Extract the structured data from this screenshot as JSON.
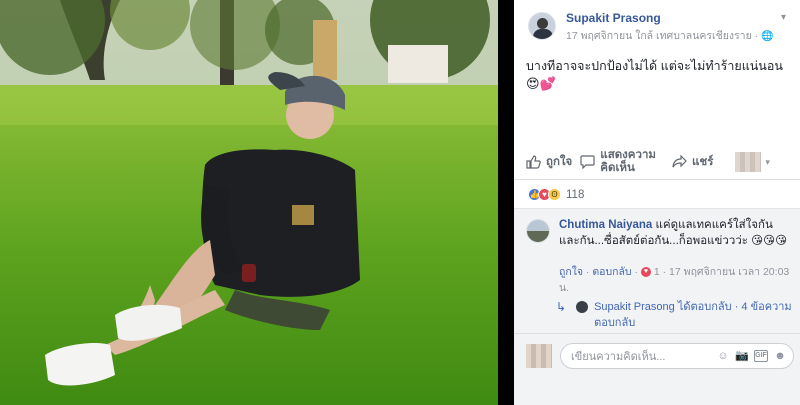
{
  "post": {
    "author": "Supakit Prasong",
    "meta": "17 พฤศจิกายน ใกล้ เทศบาลนครเชียงราย · ",
    "text": "บางทีอาจจะปกป้องไม่ได้ แต่จะไม่ทำร้ายแน่นอน",
    "text_emojis": "😍💕"
  },
  "actions": {
    "like": "ถูกใจ",
    "comment_line1": "แสดงความ",
    "comment_line2": "คิดเห็น",
    "share": "แชร์"
  },
  "reactions": {
    "count": "118",
    "types": [
      "like-icon",
      "love-icon",
      "wow-icon"
    ]
  },
  "comment": {
    "author": "Chutima Naiyana",
    "text": "แค่ดูแลเทคแคร์ใส่ใจกันและกัน...ซื่อสัตย์ต่อกัน...ก็อพอแข่ววว่ะ",
    "emojis": "😘😘😘",
    "like_link": "ถูกใจ",
    "reply_link": "ตอบกลับ",
    "reaction_count": "1",
    "timestamp": "17 พฤศจิกายน เวลา 20:03 น."
  },
  "reply": {
    "author": "Supakit Prasong",
    "label": "ได้ตอบกลับ",
    "dot": " · ",
    "count_text": "4 ข้อความตอบกลับ"
  },
  "composer": {
    "placeholder": "เขียนความคิดเห็น..."
  },
  "colors": {
    "link": "#365899",
    "muted": "#90949c",
    "panel_bg": "#ffffff",
    "comments_bg": "#f2f3f5"
  }
}
